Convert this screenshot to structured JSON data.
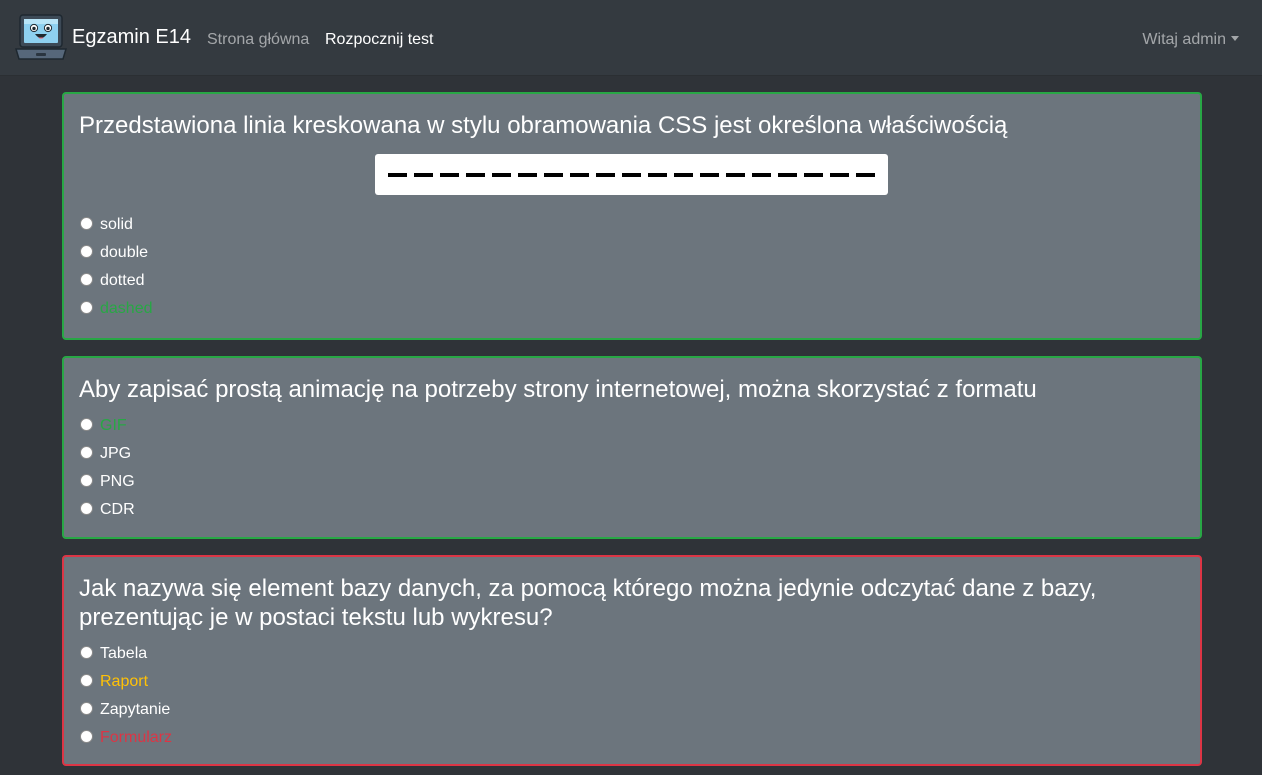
{
  "navbar": {
    "brand": "Egzamin E14",
    "links": [
      "Strona główna",
      "Rozpocznij test"
    ],
    "user_menu": "Witaj admin"
  },
  "questions": [
    {
      "text": "Przedstawiona linia kreskowana w stylu obramowania CSS jest określona właściwością",
      "answers": [
        "solid",
        "double",
        "dotted",
        "dashed"
      ]
    },
    {
      "text": "Aby zapisać prostą animację na potrzeby strony internetowej, można skorzystać z formatu",
      "answers": [
        "GIF",
        "JPG",
        "PNG",
        "CDR"
      ]
    },
    {
      "text": "Jak nazywa się element bazy danych, za pomocą którego można jedynie odczytać dane z bazy, prezentując je w postaci tekstu lub wykresu?",
      "answers": [
        "Tabela",
        "Raport",
        "Zapytanie",
        "Formularz"
      ]
    }
  ],
  "colors": {
    "navbar_bg": "#343a40",
    "page_bg": "#2f3338",
    "card_bg": "#6c757d",
    "correct": "#28a745",
    "wrong": "#dc3545",
    "hint": "#ffc107"
  },
  "icons": {
    "brand_logo": "laptop-mascot-icon",
    "user_menu": "caret-down-icon"
  }
}
